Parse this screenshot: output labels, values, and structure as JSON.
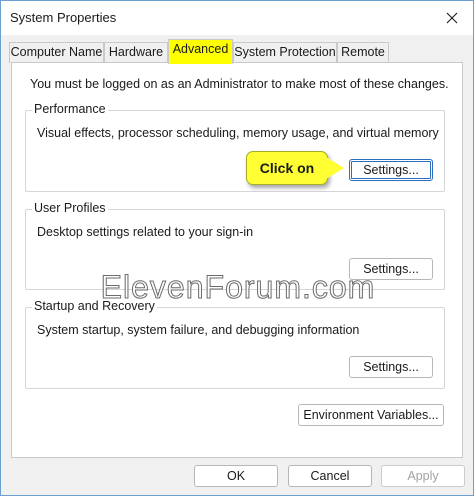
{
  "window": {
    "title": "System Properties",
    "close_glyph": "✕"
  },
  "tabs": [
    {
      "label": "Computer Name"
    },
    {
      "label": "Hardware"
    },
    {
      "label": "Advanced"
    },
    {
      "label": "System Protection"
    },
    {
      "label": "Remote"
    }
  ],
  "active_tab": "Advanced",
  "notice": "You must be logged on as an Administrator to make most of these changes.",
  "performance": {
    "title": "Performance",
    "description": "Visual effects, processor scheduling, memory usage, and virtual memory",
    "button": "Settings..."
  },
  "user_profiles": {
    "title": "User Profiles",
    "description": "Desktop settings related to your sign-in",
    "button": "Settings..."
  },
  "startup_recovery": {
    "title": "Startup and Recovery",
    "description": "System startup, system failure, and debugging information",
    "button": "Settings..."
  },
  "environment_button": "Environment Variables...",
  "callout": "Click on",
  "watermark": "ElevenForum.com",
  "footer": {
    "ok": "OK",
    "cancel": "Cancel",
    "apply": "Apply"
  },
  "colors": {
    "active_tab_highlight": "#ffff00",
    "callout": "#ffff33",
    "focus_border": "#2f6dbd"
  }
}
